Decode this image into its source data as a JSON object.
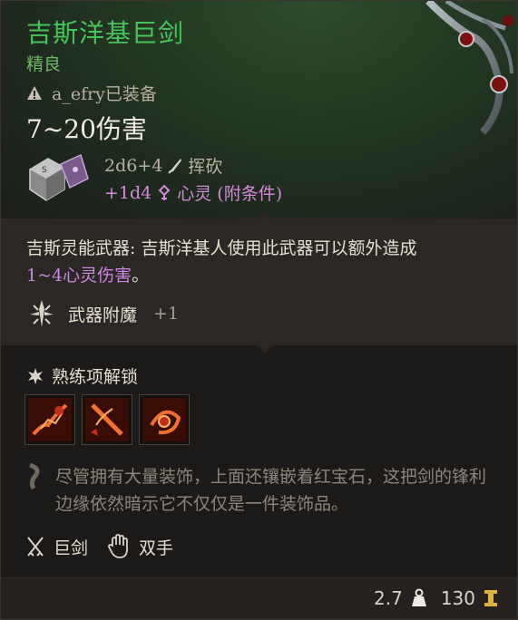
{
  "item": {
    "name": "吉斯洋基巨剑",
    "rarity": "精良",
    "equipped_by": "a_efry已装备",
    "damage": "7~20伤害",
    "base_damage": "2d6+4",
    "base_damage_type": "挥砍",
    "bonus_damage": "+1d4",
    "bonus_damage_type": "心灵 (附条件)",
    "colors": {
      "name": "#46c45a",
      "rarity": "#6fb865",
      "psychic": "#d48ad8"
    }
  },
  "description": {
    "prefix": "吉斯灵能武器: 吉斯洋基人使用此武器可以额外造成",
    "highlight": "1~4心灵伤害",
    "suffix": "。"
  },
  "enchantment": {
    "label": "武器附魔",
    "value": "+1"
  },
  "proficiency": {
    "title": "熟练项解锁",
    "icons": [
      "flame-strike-icon",
      "rush-attack-icon",
      "cleave-icon"
    ]
  },
  "flavor_text": "尽管拥有大量装饰，上面还镶嵌着红宝石，这把剑的锋利边缘依然暗示它不仅仅是一件装饰品。",
  "tags": [
    {
      "icon": "crossed-swords-icon",
      "label": "巨剑"
    },
    {
      "icon": "hand-icon",
      "label": "双手"
    }
  ],
  "footer": {
    "weight": "2.7",
    "value": "130"
  }
}
